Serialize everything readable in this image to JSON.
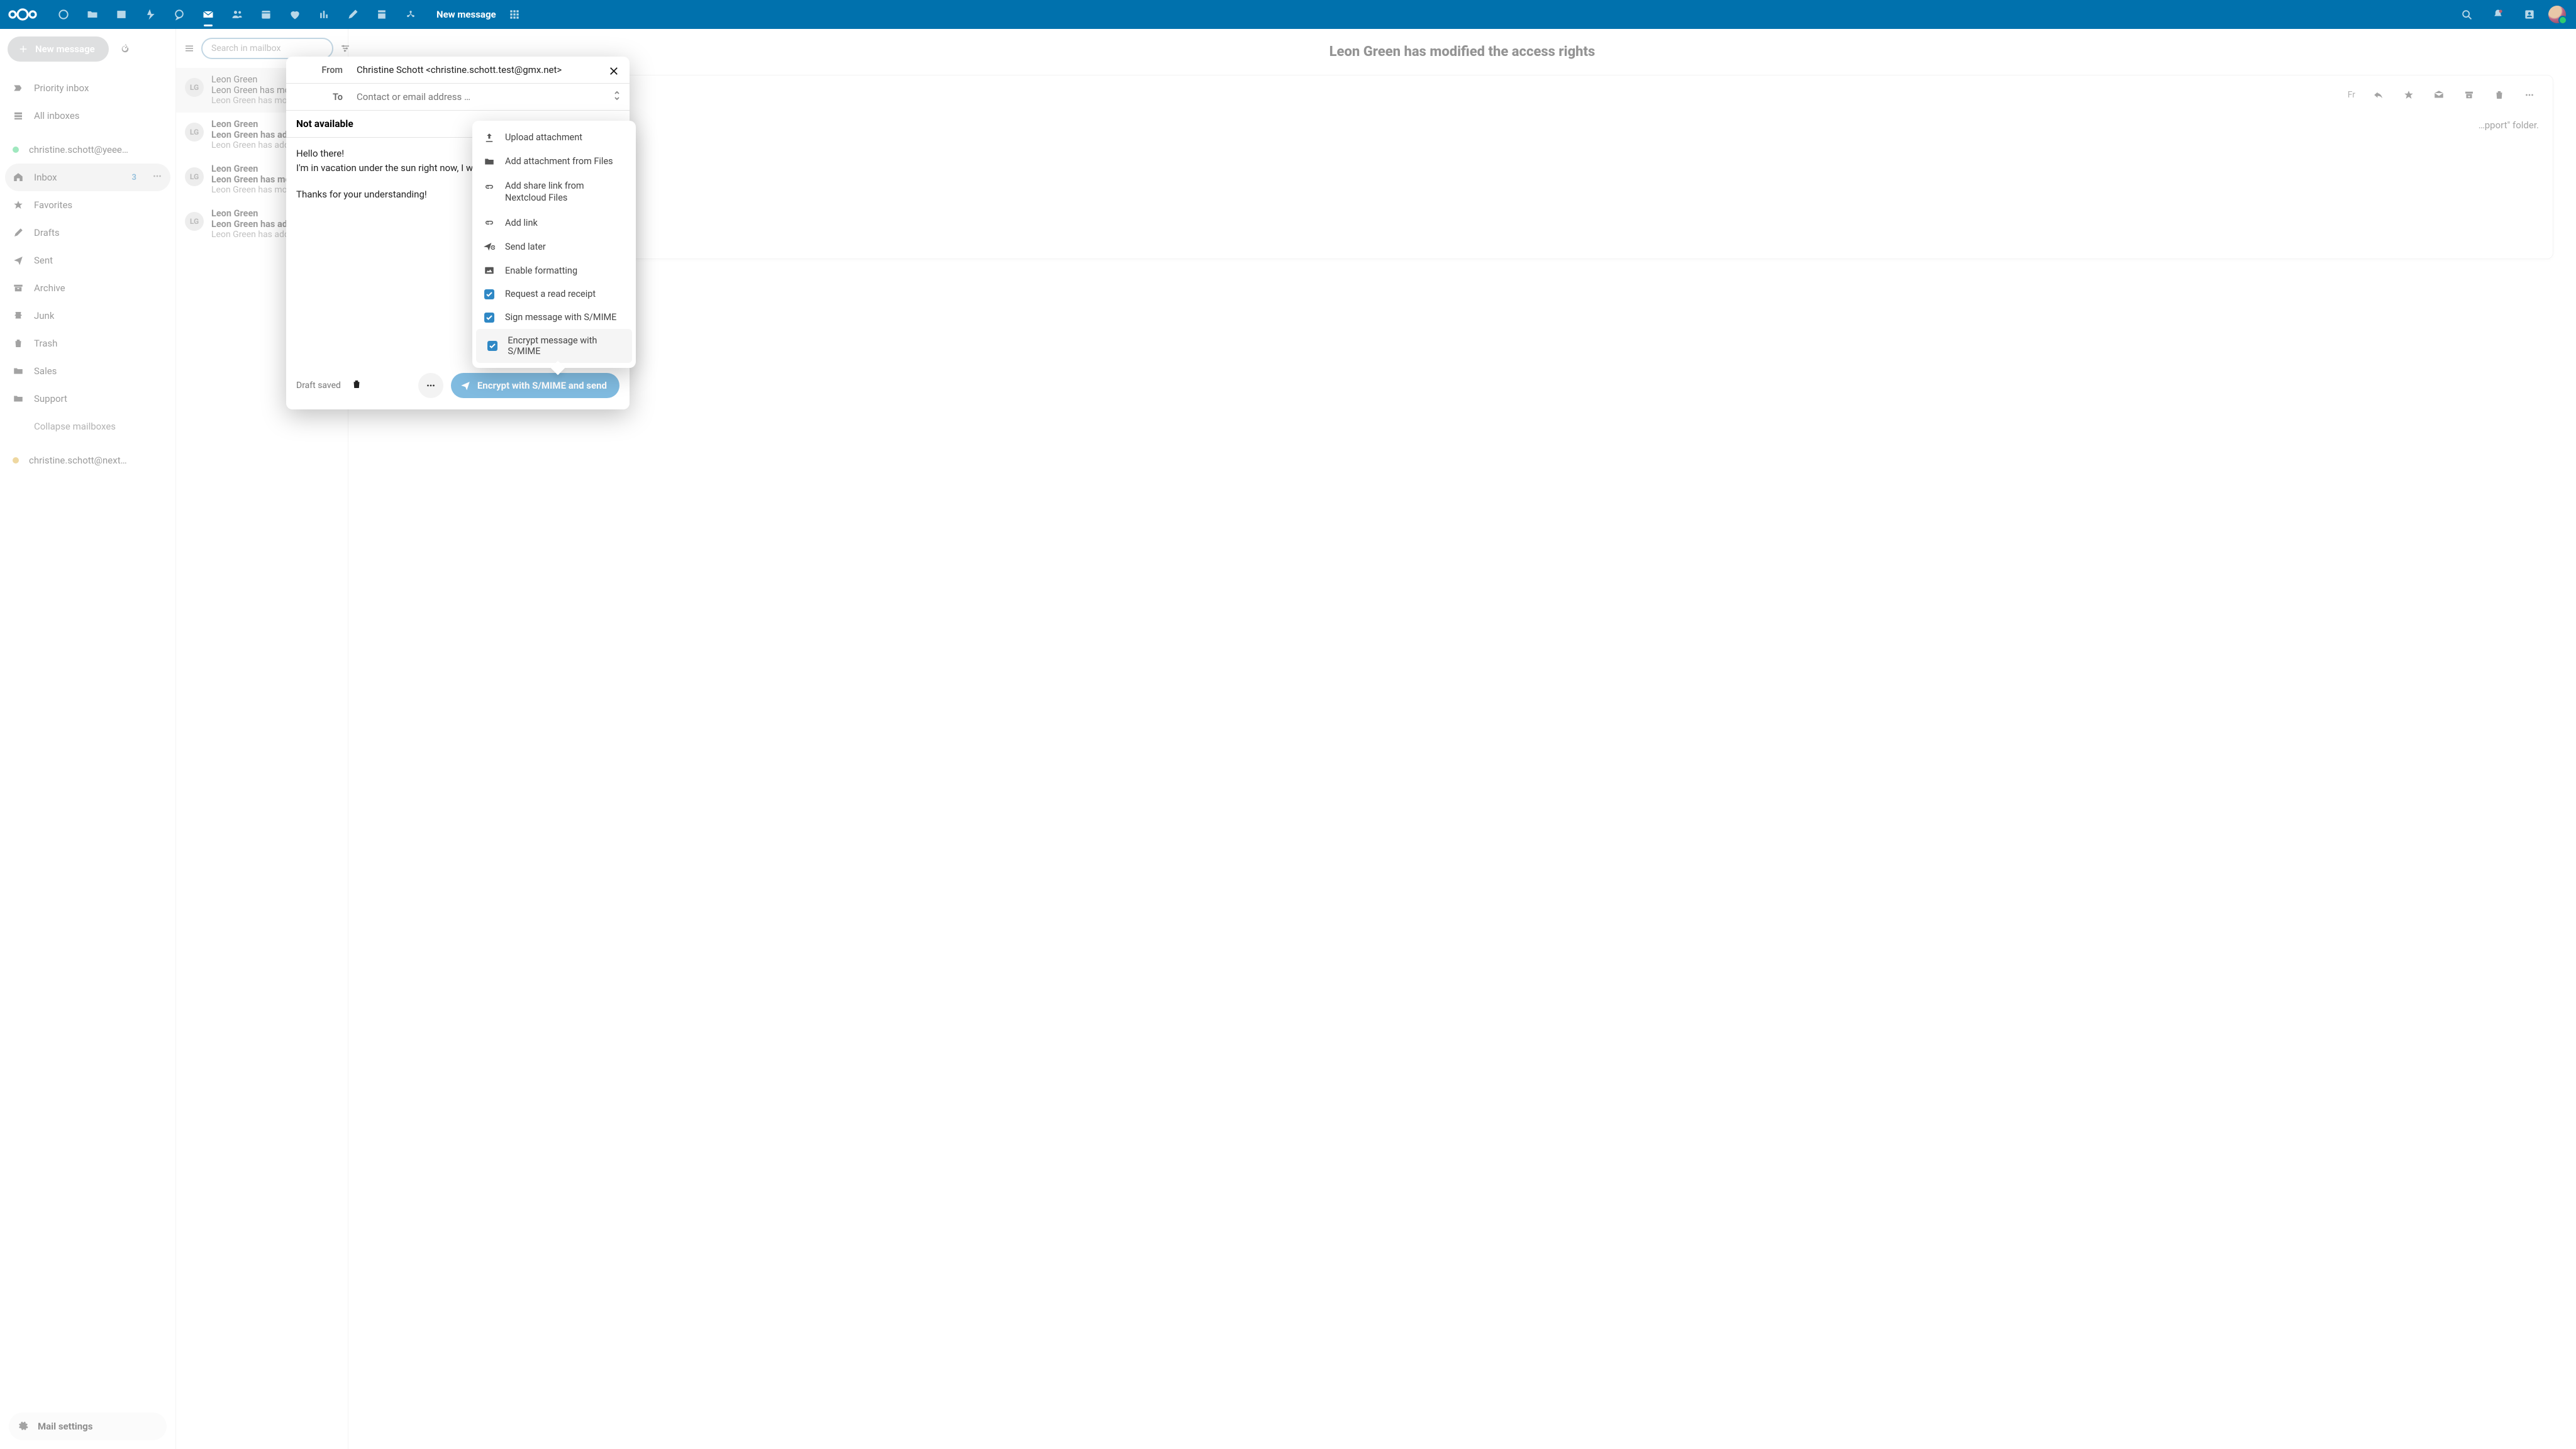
{
  "topbar": {
    "title": "New message"
  },
  "sidebar": {
    "new_message": "New message",
    "priority_inbox": "Priority inbox",
    "all_inboxes": "All inboxes",
    "account1": "christine.schott@yeeeh…",
    "account2": "christine.schott@nextcl…",
    "inbox": "Inbox",
    "inbox_count": "3",
    "favorites": "Favorites",
    "drafts": "Drafts",
    "sent": "Sent",
    "archive": "Archive",
    "junk": "Junk",
    "trash": "Trash",
    "sales": "Sales",
    "support": "Support",
    "collapse": "Collapse mailboxes",
    "mail_settings": "Mail settings"
  },
  "threads": {
    "search_placeholder": "Search in mailbox",
    "items": [
      {
        "initials": "LG",
        "from": "Leon Green",
        "subj": "Leon Green has moc",
        "prev": "Leon Green has mod",
        "unread": false
      },
      {
        "initials": "LG",
        "from": "Leon Green",
        "subj": "Leon Green has add",
        "prev": "Leon Green has add",
        "unread": true
      },
      {
        "initials": "LG",
        "from": "Leon Green",
        "subj": "Leon Green has mo",
        "prev": "Leon Green has mod",
        "unread": true
      },
      {
        "initials": "LG",
        "from": "Leon Green",
        "subj": "Leon Green has add",
        "prev": "Leon Green has add",
        "unread": true
      }
    ]
  },
  "reader": {
    "title": "Leon Green has modified the access rights",
    "date_short": "Fr",
    "body_line": "…pport\" folder."
  },
  "compose": {
    "from_label": "From",
    "from_value": "Christine Schott <christine.schott.test@gmx.net>",
    "to_label": "To",
    "to_placeholder": "Contact or email address …",
    "subject": "Not available",
    "body_l1": "Hello there!",
    "body_l2": "I'm in vacation under the sun right now, I will se",
    "body_l3": "Thanks for your understanding!",
    "draft_saved": "Draft saved",
    "send_label": "Encrypt with S/MIME and send"
  },
  "popover": {
    "upload": "Upload attachment",
    "from_files": "Add attachment from Files",
    "share_link": "Add share link from Nextcloud Files",
    "add_link": "Add link",
    "send_later": "Send later",
    "enable_formatting": "Enable formatting",
    "read_receipt": "Request a read receipt",
    "sign_smime": "Sign message with S/MIME",
    "encrypt_smime": "Encrypt message with S/MIME"
  }
}
